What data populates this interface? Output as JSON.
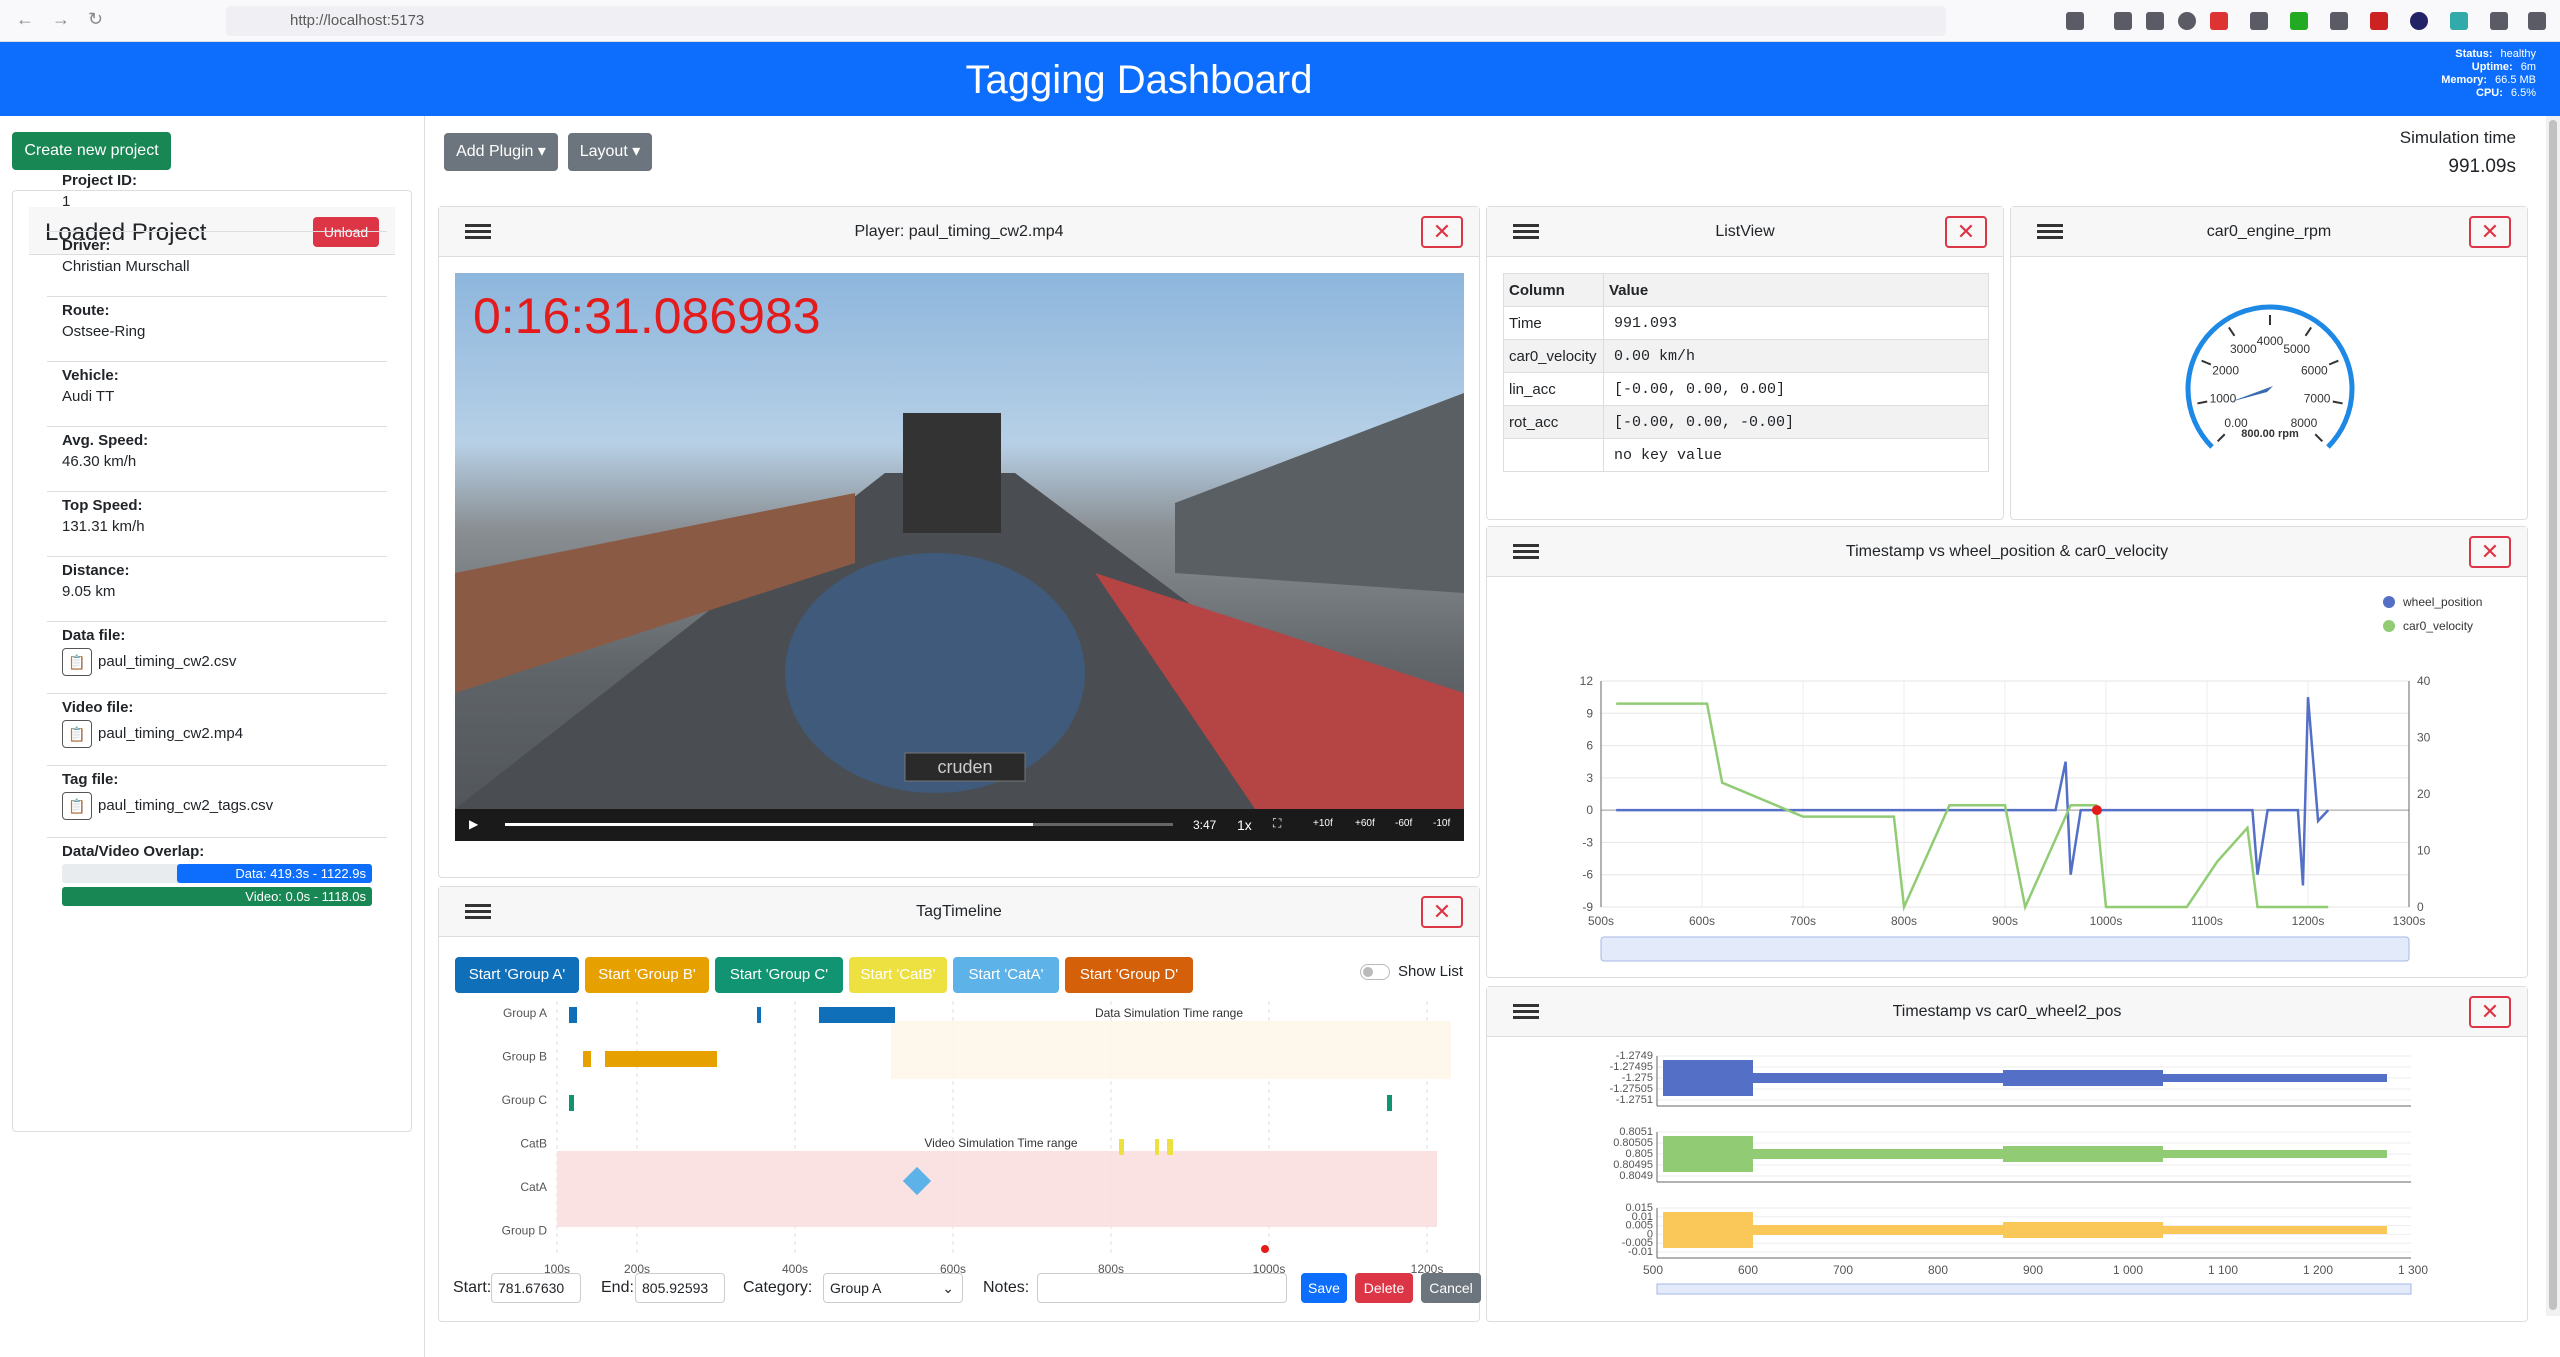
{
  "browser": {
    "url": "http://localhost:5173"
  },
  "header": {
    "title": "Tagging Dashboard",
    "status_label": "Status:",
    "status": "healthy",
    "uptime_label": "Uptime:",
    "uptime": "6m",
    "memory_label": "Memory:",
    "memory": "66.5 MB",
    "cpu_label": "CPU:",
    "cpu": "6.5%"
  },
  "sidebar": {
    "create_btn": "Create new project",
    "title": "Loaded Project",
    "unload": "Unload",
    "fields": [
      {
        "label": "Project ID:",
        "value": "1"
      },
      {
        "label": "Driver:",
        "value": "Christian Murschall"
      },
      {
        "label": "Route:",
        "value": "Ostsee-Ring"
      },
      {
        "label": "Vehicle:",
        "value": "Audi TT"
      },
      {
        "label": "Avg. Speed:",
        "value": "46.30 km/h"
      },
      {
        "label": "Top Speed:",
        "value": "131.31 km/h"
      },
      {
        "label": "Distance:",
        "value": "9.05 km"
      }
    ],
    "files": [
      {
        "label": "Data file:",
        "value": "paul_timing_cw2.csv"
      },
      {
        "label": "Video file:",
        "value": "paul_timing_cw2.mp4"
      },
      {
        "label": "Tag file:",
        "value": "paul_timing_cw2_tags.csv"
      }
    ],
    "overlap_label": "Data/Video Overlap:",
    "data_bar": "Data: 419.3s - 1122.9s",
    "video_bar": "Video: 0.0s - 1118.0s",
    "data_bar_start_frac": 0.37,
    "video_bar_frac": 1.0
  },
  "toolbar": {
    "add_plugin": "Add Plugin",
    "layout": "Layout",
    "sim_label": "Simulation time",
    "sim_value": "991.09s"
  },
  "player": {
    "title": "Player: paul_timing_cw2.mp4",
    "timecode": "0:16:31.086983",
    "duration": "3:47",
    "speed": "1x",
    "controls": [
      "+10f",
      "+60f",
      "-60f",
      "-10f"
    ],
    "progress": 0.79,
    "plate": "cruden"
  },
  "listview": {
    "title": "ListView",
    "headers": [
      "Column",
      "Value"
    ],
    "rows": [
      [
        "Time",
        "991.093"
      ],
      [
        "car0_velocity",
        "0.00 km/h"
      ],
      [
        "lin_acc",
        "[-0.00, 0.00, 0.00]"
      ],
      [
        "rot_acc",
        "[-0.00, 0.00, -0.00]"
      ],
      [
        "",
        "no key value"
      ]
    ]
  },
  "gauge": {
    "title": "car0_engine_rpm",
    "ticks": [
      "0.00",
      "1000",
      "2000",
      "3000",
      "4000",
      "5000",
      "6000",
      "7000",
      "8000"
    ],
    "value": "800.00 rpm",
    "needle_rpm": 800,
    "color": "#1e88e5"
  },
  "tag_timeline": {
    "title": "TagTimeline",
    "buttons": [
      {
        "label": "Start 'Group A'",
        "color": "#0f6fb8"
      },
      {
        "label": "Start 'Group B'",
        "color": "#e6a100"
      },
      {
        "label": "Start 'Group C'",
        "color": "#119472"
      },
      {
        "label": "Start 'CatB'",
        "color": "#ede041"
      },
      {
        "label": "Start 'CatA'",
        "color": "#5db3e8"
      },
      {
        "label": "Start 'Group D'",
        "color": "#d4600a"
      }
    ],
    "show_list": "Show List",
    "rows": [
      "Group A",
      "Group B",
      "Group C",
      "CatB",
      "CatA",
      "Group D"
    ],
    "x_ticks": [
      "100s",
      "200s",
      "400s",
      "600s",
      "800s",
      "1000s",
      "1200s"
    ],
    "data_range_label": "Data Simulation Time range",
    "video_range_label": "Video Simulation Time range",
    "form": {
      "start_label": "Start:",
      "start": "781.67630",
      "end_label": "End:",
      "end": "805.92593",
      "category_label": "Category:",
      "category": "Group A",
      "notes_label": "Notes:",
      "save": "Save",
      "delete": "Delete",
      "cancel": "Cancel"
    }
  },
  "chart1": {
    "title": "Timestamp vs wheel_position & car0_velocity"
  },
  "chart2": {
    "title": "Timestamp vs car0_wheel2_pos"
  },
  "chart_data": [
    {
      "type": "line",
      "title": "Timestamp vs wheel_position & car0_velocity",
      "xlim": [
        500,
        1300
      ],
      "x_ticks": [
        "500s",
        "600s",
        "700s",
        "800s",
        "900s",
        "1000s",
        "1100s",
        "1200s",
        "1300s"
      ],
      "ylim_left": [
        -9,
        12
      ],
      "y_ticks_left": [
        "12",
        "9",
        "6",
        "3",
        "0",
        "-3",
        "-6",
        "-9"
      ],
      "ylim_right": [
        0,
        40
      ],
      "y_ticks_right": [
        "40",
        "30",
        "20",
        "10",
        "0"
      ],
      "legend": "top-right",
      "series": [
        {
          "name": "wheel_position",
          "color": "#5470c6",
          "x": [
            515,
            600,
            700,
            800,
            900,
            950,
            960,
            965,
            975,
            1000,
            1100,
            1145,
            1150,
            1160,
            1190,
            1195,
            1200,
            1210,
            1220
          ],
          "y": [
            0,
            0,
            0,
            0,
            0,
            0,
            4.5,
            -6,
            0,
            0,
            0,
            0,
            -6,
            0,
            0,
            -7,
            10.5,
            -1,
            0
          ]
        },
        {
          "name": "car0_velocity",
          "color": "#91cc75",
          "x": [
            515,
            600,
            605,
            620,
            700,
            790,
            800,
            845,
            900,
            920,
            965,
            990,
            1000,
            1080,
            1110,
            1140,
            1150,
            1190,
            1220
          ],
          "y": [
            36,
            36,
            36,
            22,
            16,
            16,
            0,
            18,
            18,
            0,
            18,
            18,
            0,
            0,
            8,
            14,
            0,
            0,
            0
          ]
        }
      ]
    },
    {
      "type": "line",
      "title": "Timestamp vs car0_wheel2_pos",
      "x_ticks": [
        "500",
        "600",
        "700",
        "800",
        "900",
        "1 000",
        "1 100",
        "1 200",
        "1 300"
      ],
      "series": [
        {
          "color": "#5470c6",
          "y_ticks": [
            "-1.2749",
            "-1.27495",
            "-1.275",
            "-1.27505",
            "-1.2751"
          ]
        },
        {
          "color": "#91cc75",
          "y_ticks": [
            "0.8051",
            "0.80505",
            "0.805",
            "0.80495",
            "0.8049"
          ]
        },
        {
          "color": "#fac858",
          "y_ticks": [
            "0.015",
            "0.01",
            "0.005",
            "0",
            "-0.005",
            "-0.01"
          ]
        }
      ]
    }
  ]
}
